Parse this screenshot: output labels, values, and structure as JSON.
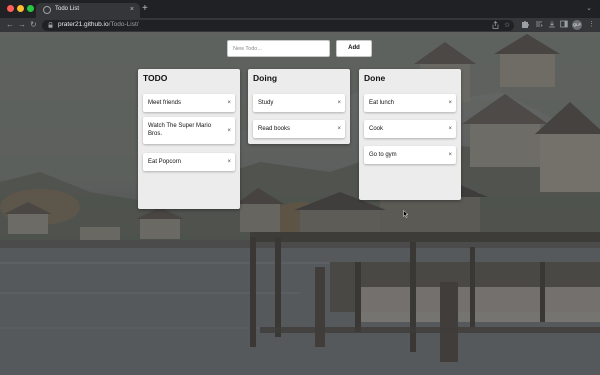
{
  "browser": {
    "tab_title": "Todo List",
    "url_host": "prater21.github.io",
    "url_path": "/Todo-List/",
    "profile_initials": "QLF"
  },
  "form": {
    "input_placeholder": "New Todo...",
    "input_value": "",
    "add_label": "Add"
  },
  "columns": [
    {
      "title": "TODO",
      "items": [
        "Meet friends",
        "Watch The Super Mario Bros.",
        "Eat Popcorn"
      ]
    },
    {
      "title": "Doing",
      "items": [
        "Study",
        "Read books"
      ]
    },
    {
      "title": "Done",
      "items": [
        "Eat lunch",
        "Cook",
        "Go to gym"
      ]
    }
  ],
  "delete_glyph": "×",
  "icons": {
    "close": "×",
    "new_tab": "+",
    "back": "←",
    "forward": "→",
    "reload": "↻",
    "share": "share-icon",
    "star": "☆",
    "extensions": "puzzle-icon",
    "reading_list": "reading-list-icon",
    "download": "download-icon",
    "side_panel": "side-panel-icon",
    "menu": "⋮",
    "dropdown": "⌄"
  }
}
